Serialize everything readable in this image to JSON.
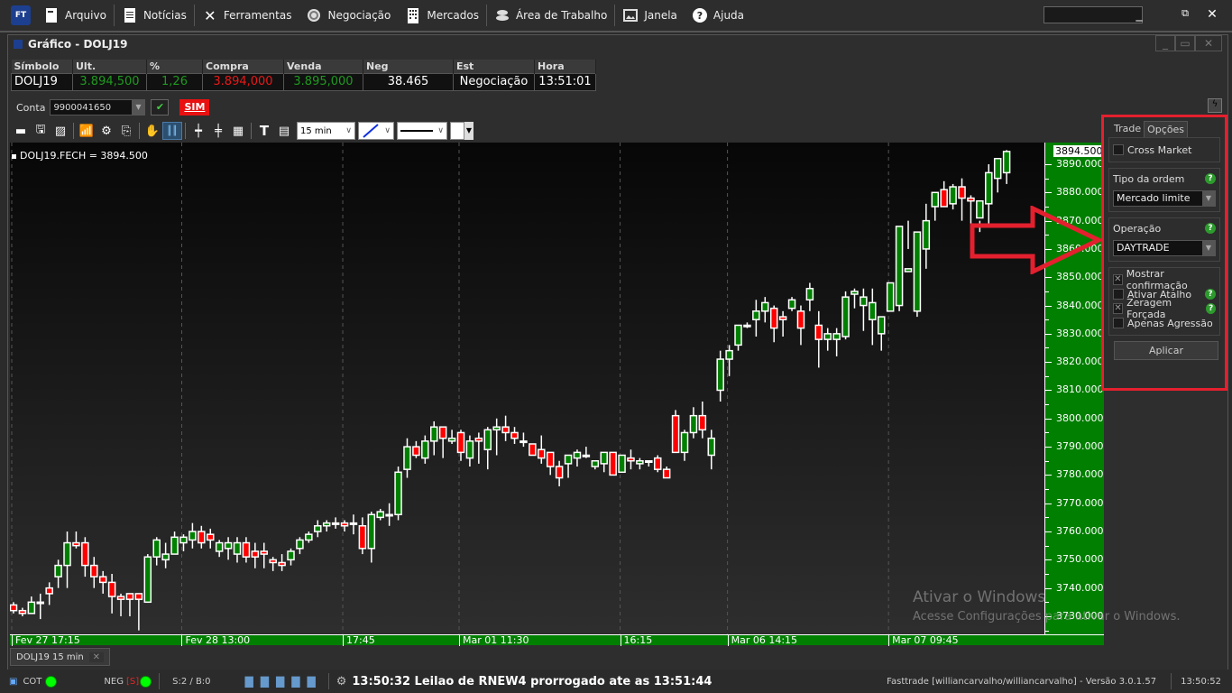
{
  "menubar": {
    "logo": "FT",
    "items": [
      {
        "label": "Arquivo",
        "icon": "file-icon"
      },
      {
        "label": "Notícias",
        "icon": "news-icon"
      },
      {
        "label": "Ferramentas",
        "icon": "tools-icon"
      },
      {
        "label": "Negociação",
        "icon": "negotiation-icon"
      },
      {
        "label": "Mercados",
        "icon": "building-icon"
      },
      {
        "label": "Área de Trabalho",
        "icon": "workspace-icon"
      },
      {
        "label": "Janela",
        "icon": "window-icon"
      },
      {
        "label": "Ajuda",
        "icon": "help-icon"
      }
    ],
    "search_value": ""
  },
  "window": {
    "title": "Gráfico - DOLJ19"
  },
  "quote": {
    "headers": [
      "Símbolo",
      "Ult.",
      "%",
      "Compra",
      "Venda",
      "Neg",
      "Est",
      "Hora"
    ],
    "values": [
      "DOLJ19",
      "3.894,500",
      "1,26",
      "3.894,000",
      "3.895,000",
      "38.465",
      "Negociação",
      "13:51:01"
    ],
    "colors": [
      "white",
      "green",
      "green",
      "red",
      "green",
      "white",
      "white",
      "white"
    ]
  },
  "account": {
    "label": "Conta",
    "value": "9900041650",
    "sim_label": "SIM"
  },
  "toolbar": {
    "interval": "15 min"
  },
  "chart_data": {
    "type": "candlestick",
    "title": "DOLJ19 15 min",
    "legend": "DOLJ19.FECH = 3894.500",
    "last_price_label": "3894.500",
    "ylim": [
      3725,
      3897
    ],
    "yticks": [
      "3890.000",
      "3880.000",
      "3870.000",
      "3860.000",
      "3850.000",
      "3840.000",
      "3830.000",
      "3820.000",
      "3810.000",
      "3800.000",
      "3790.000",
      "3780.000",
      "3770.000",
      "3760.000",
      "3750.000",
      "3740.000",
      "3730.000"
    ],
    "xticks": [
      {
        "label": "Fev 27 17:15",
        "index": 0
      },
      {
        "label": "Fev 28 13:00",
        "index": 19
      },
      {
        "label": "17:45",
        "index": 37
      },
      {
        "label": "Mar 01 11:30",
        "index": 50
      },
      {
        "label": "16:15",
        "index": 68
      },
      {
        "label": "Mar 06 14:15",
        "index": 80
      },
      {
        "label": "Mar 07 09:45",
        "index": 98
      }
    ],
    "candles": [
      [
        3734,
        3735,
        3731,
        3732
      ],
      [
        3732,
        3733,
        3730,
        3731
      ],
      [
        3731,
        3737,
        3731,
        3735
      ],
      [
        3735,
        3738,
        3729,
        3735
      ],
      [
        3740,
        3742,
        3734,
        3738
      ],
      [
        3744,
        3750,
        3740,
        3748
      ],
      [
        3748,
        3760,
        3740,
        3756
      ],
      [
        3756,
        3760,
        3754,
        3755
      ],
      [
        3756,
        3758,
        3744,
        3748
      ],
      [
        3748,
        3751,
        3740,
        3744
      ],
      [
        3744,
        3746,
        3738,
        3742
      ],
      [
        3742,
        3745,
        3731,
        3737
      ],
      [
        3737,
        3738,
        3730,
        3736
      ],
      [
        3738,
        3737,
        3730,
        3736
      ],
      [
        3738,
        3736,
        3725,
        3736
      ],
      [
        3735,
        3752,
        3735,
        3751
      ],
      [
        3751,
        3758,
        3748,
        3757
      ],
      [
        3750,
        3756,
        3747,
        3752
      ],
      [
        3752,
        3760,
        3752,
        3758
      ],
      [
        3756,
        3759,
        3753,
        3758
      ],
      [
        3757,
        3763,
        3754,
        3760
      ],
      [
        3760,
        3762,
        3754,
        3756
      ],
      [
        3759,
        3761,
        3754,
        3757
      ],
      [
        3753,
        3757,
        3751,
        3756
      ],
      [
        3754,
        3758,
        3750,
        3756
      ],
      [
        3752,
        3758,
        3749,
        3756
      ],
      [
        3756,
        3758,
        3749,
        3751
      ],
      [
        3753,
        3756,
        3747,
        3751
      ],
      [
        3753,
        3756,
        3747,
        3752
      ],
      [
        3750,
        3751,
        3746,
        3749
      ],
      [
        3749,
        3752,
        3746,
        3748
      ],
      [
        3750,
        3754,
        3748,
        3753
      ],
      [
        3754,
        3758,
        3752,
        3757
      ],
      [
        3757,
        3760,
        3756,
        3759
      ],
      [
        3760,
        3764,
        3758,
        3762
      ],
      [
        3762,
        3764,
        3760,
        3763
      ],
      [
        3763,
        3765,
        3761,
        3763
      ],
      [
        3763,
        3764,
        3760,
        3762
      ],
      [
        3763,
        3766,
        3759,
        3763
      ],
      [
        3762,
        3765,
        3752,
        3754
      ],
      [
        3754,
        3767,
        3749,
        3766
      ],
      [
        3765,
        3768,
        3764,
        3767
      ],
      [
        3766,
        3770,
        3762,
        3766
      ],
      [
        3766,
        3783,
        3764,
        3781
      ],
      [
        3782,
        3793,
        3779,
        3790
      ],
      [
        3790,
        3792,
        3786,
        3787
      ],
      [
        3786,
        3794,
        3784,
        3792
      ],
      [
        3792,
        3799,
        3787,
        3797
      ],
      [
        3797,
        3797,
        3786,
        3793
      ],
      [
        3792,
        3796,
        3791,
        3793
      ],
      [
        3795,
        3796,
        3785,
        3788
      ],
      [
        3786,
        3794,
        3783,
        3792
      ],
      [
        3793,
        3795,
        3784,
        3792
      ],
      [
        3789,
        3797,
        3782,
        3796
      ],
      [
        3796,
        3800,
        3787,
        3797
      ],
      [
        3797,
        3801,
        3792,
        3795
      ],
      [
        3795,
        3797,
        3791,
        3793
      ],
      [
        3792,
        3795,
        3790,
        3792
      ],
      [
        3791,
        3790,
        3788,
        3787
      ],
      [
        3789,
        3794,
        3784,
        3786
      ],
      [
        3788,
        3788,
        3780,
        3783
      ],
      [
        3783,
        3785,
        3776,
        3779
      ],
      [
        3784,
        3787,
        3779,
        3787
      ],
      [
        3786,
        3789,
        3783,
        3788
      ],
      [
        3787,
        3790,
        3786,
        3787
      ],
      [
        3783,
        3785,
        3782,
        3785
      ],
      [
        3784,
        3788,
        3781,
        3788
      ],
      [
        3788,
        3788,
        3781,
        3780
      ],
      [
        3781,
        3786,
        3781,
        3787
      ],
      [
        3786,
        3789,
        3782,
        3785
      ],
      [
        3784,
        3786,
        3782,
        3785
      ],
      [
        3785,
        3785,
        3783,
        3785
      ],
      [
        3786,
        3787,
        3781,
        3782
      ],
      [
        3782,
        3783,
        3779,
        3779
      ],
      [
        3801,
        3803,
        3788,
        3788
      ],
      [
        3788,
        3796,
        3785,
        3795
      ],
      [
        3795,
        3804,
        3793,
        3801
      ],
      [
        3801,
        3806,
        3793,
        3796
      ],
      [
        3787,
        3796,
        3782,
        3793
      ],
      [
        3810,
        3824,
        3806,
        3821
      ],
      [
        3821,
        3826,
        3815,
        3824
      ],
      [
        3826,
        3833,
        3824,
        3833
      ],
      [
        3833,
        3834,
        3832,
        3833
      ],
      [
        3835,
        3842,
        3829,
        3838
      ],
      [
        3838,
        3843,
        3834,
        3841
      ],
      [
        3839,
        3840,
        3827,
        3832
      ],
      [
        3836,
        3838,
        3829,
        3835
      ],
      [
        3839,
        3843,
        3838,
        3842
      ],
      [
        3838,
        3840,
        3826,
        3832
      ],
      [
        3842,
        3848,
        3838,
        3846
      ],
      [
        3833,
        3838,
        3818,
        3828
      ],
      [
        3828,
        3832,
        3824,
        3830
      ],
      [
        3828,
        3832,
        3822,
        3830
      ],
      [
        3829,
        3845,
        3828,
        3843
      ],
      [
        3844,
        3846,
        3839,
        3845
      ],
      [
        3840,
        3846,
        3831,
        3843
      ],
      [
        3835,
        3846,
        3826,
        3841
      ],
      [
        3830,
        3835,
        3824,
        3836
      ],
      [
        3838,
        3844,
        3838,
        3848
      ],
      [
        3840,
        3858,
        3838,
        3868
      ],
      [
        3852,
        3870,
        3860,
        3853
      ],
      [
        3838,
        3855,
        3836,
        3866
      ],
      [
        3860,
        3876,
        3853,
        3870
      ],
      [
        3875,
        3880,
        3870,
        3880
      ],
      [
        3881,
        3884,
        3875,
        3875
      ],
      [
        3876,
        3883,
        3874,
        3882
      ],
      [
        3882,
        3885,
        3870,
        3878
      ],
      [
        3878,
        3879,
        3862,
        3877
      ],
      [
        3871,
        3870,
        3866,
        3877
      ],
      [
        3876,
        3890,
        3868,
        3887
      ],
      [
        3885,
        3890,
        3880,
        3892
      ],
      [
        3887,
        3895,
        3883,
        3894.5
      ]
    ]
  },
  "panel": {
    "tabs": [
      "Trade",
      "Opções"
    ],
    "active_tab": "Opções",
    "cross_market": {
      "label": "Cross Market",
      "checked": false
    },
    "order_type": {
      "label": "Tipo da ordem",
      "value": "Mercado limite"
    },
    "operation": {
      "label": "Operação",
      "value": "DAYTRADE"
    },
    "options": [
      {
        "label": "Mostrar confirmação",
        "checked": true,
        "help": false
      },
      {
        "label": "Ativar Atalho",
        "checked": false,
        "help": true
      },
      {
        "label": "Zeragem Forçada",
        "checked": true,
        "help": true
      },
      {
        "label": "Apenas Agressão",
        "checked": false,
        "help": false
      }
    ],
    "apply_label": "Aplicar"
  },
  "chart_tab": {
    "label": "DOLJ19 15 min"
  },
  "watermark": {
    "line1": "Ativar o Windows",
    "line2": "Acesse Configurações para ativar o Windows."
  },
  "statusbar": {
    "cot": "COT",
    "neg": "NEG",
    "neg_flag": "[S]",
    "sb": "S:2 / B:0",
    "message": "13:50:32 Leilao de RNEW4 prorrogado ate as 13:51:44",
    "app_info": "Fasttrade [williancarvalho/williancarvalho] - Versão 3.0.1.57",
    "clock": "13:50:52"
  },
  "colors": {
    "up": "#008000",
    "down": "#ff0000",
    "axis_bg": "#007f00",
    "highlight": "#e4202e"
  }
}
